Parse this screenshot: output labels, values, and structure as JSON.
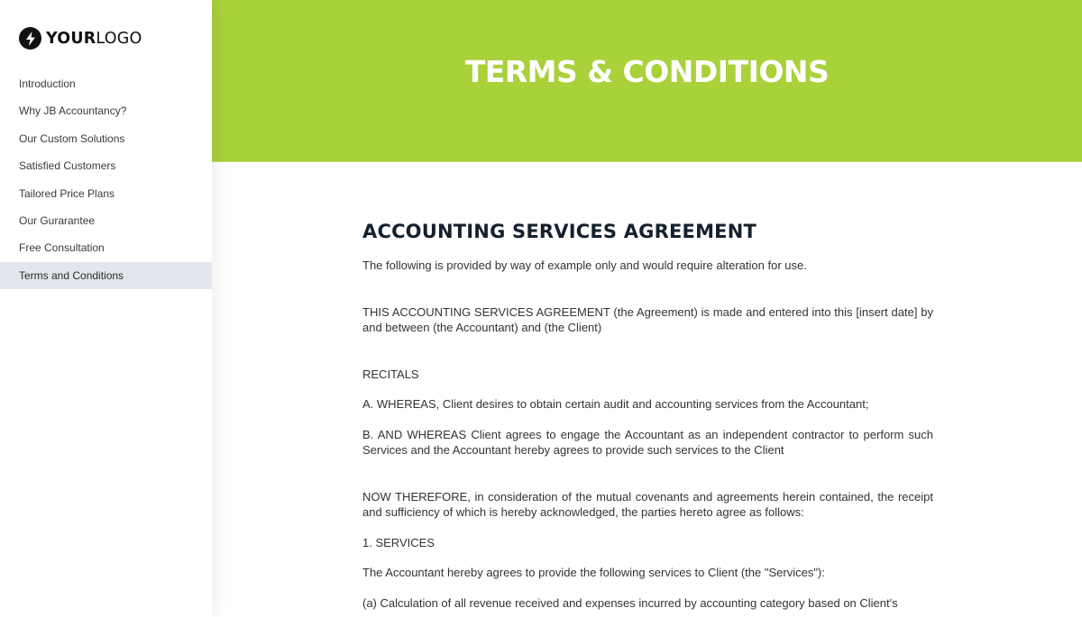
{
  "sidebar": {
    "logo": {
      "bold": "YOUR",
      "light": "LOGO",
      "icon": "lightning-bolt-icon"
    },
    "items": [
      {
        "label": "Introduction",
        "active": false
      },
      {
        "label": "Why JB Accountancy?",
        "active": false
      },
      {
        "label": "Our Custom Solutions",
        "active": false
      },
      {
        "label": "Satisfied Customers",
        "active": false
      },
      {
        "label": "Tailored Price Plans",
        "active": false
      },
      {
        "label": "Our Gurarantee",
        "active": false
      },
      {
        "label": "Free Consultation",
        "active": false
      },
      {
        "label": "Terms and Conditions",
        "active": true
      }
    ]
  },
  "hero": {
    "title": "TERMS & CONDITIONS",
    "background": "#a9d13a"
  },
  "document": {
    "title": "ACCOUNTING SERVICES AGREEMENT",
    "note": "The following is provided by way of example only and would require alteration for use.",
    "intro": "THIS ACCOUNTING SERVICES AGREEMENT (the Agreement) is made and entered into this [insert date] by and between (the Accountant) and (the Client)",
    "recitals_heading": "RECITALS",
    "recital_a": "A. WHEREAS, Client desires to obtain certain audit and accounting services from the Accountant;",
    "recital_b": "B. AND WHEREAS Client agrees to engage the Accountant as an independent contractor to perform such Services and the Accountant hereby agrees to provide such services to the Client",
    "now_therefore": "NOW THEREFORE, in consideration of the mutual covenants and agreements herein contained, the receipt and sufficiency of which is hereby acknowledged, the parties hereto agree as follows:",
    "section_1_heading": "1. SERVICES",
    "services_intro": "The Accountant hereby agrees to provide the following services to Client (the \"Services\"):",
    "service_a": "(a) Calculation of all revenue received and expenses incurred by accounting category based on Client's"
  }
}
